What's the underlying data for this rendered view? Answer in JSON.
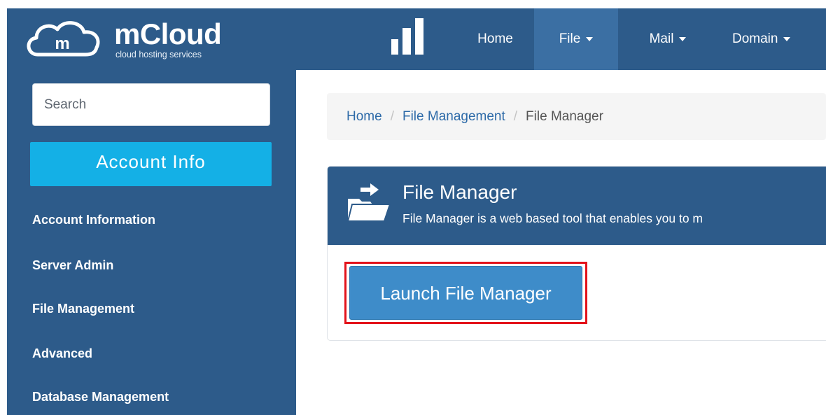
{
  "brand": {
    "logo_letter": "m",
    "title": "mCloud",
    "subtitle": "cloud hosting services"
  },
  "nav": {
    "icon": "bar-chart-icon",
    "items": [
      {
        "label": "Home",
        "dropdown": false
      },
      {
        "label": "File",
        "dropdown": true,
        "active": true
      },
      {
        "label": "Mail",
        "dropdown": true
      },
      {
        "label": "Domain",
        "dropdown": true
      }
    ]
  },
  "sidebar": {
    "search_placeholder": "Search",
    "account_button": "Account Info",
    "links": [
      "Account Information",
      "Server Admin",
      "File Management",
      "Advanced",
      "Database Management"
    ]
  },
  "breadcrumb": [
    "Home",
    "File Management",
    "File Manager"
  ],
  "panel": {
    "icon": "folder-open-icon",
    "title": "File Manager",
    "description": "File Manager is a web based tool that enables you to m"
  },
  "launch_button": "Launch File Manager",
  "colors": {
    "navbar": "#2d5b8a",
    "nav_active": "#3b6fa3",
    "account_button": "#14b0e6",
    "launch_button": "#3e8cc9",
    "highlight_border": "#e3131b"
  }
}
